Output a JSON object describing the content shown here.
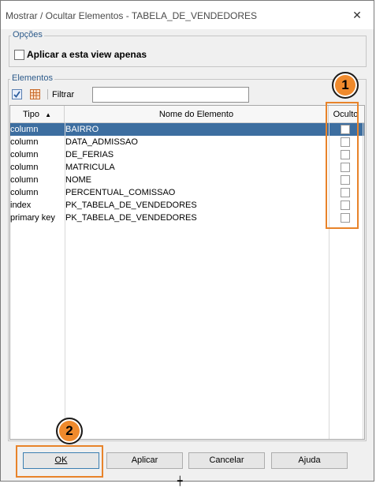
{
  "window": {
    "title": "Mostrar / Ocultar Elementos - TABELA_DE_VENDEDORES",
    "close_glyph": "✕"
  },
  "options": {
    "group_label": "Opções",
    "apply_view_only_label": "Aplicar a esta view apenas",
    "apply_view_only_checked": false
  },
  "elements": {
    "group_label": "Elementos",
    "toolbar": {
      "select_all_icon": "check-all-icon",
      "grid_icon": "table-grid-icon",
      "filter_label": "Filtrar",
      "filter_value": ""
    },
    "table": {
      "columns": {
        "type": "Tipo",
        "name": "Nome do Elemento",
        "hidden": "Oculto"
      },
      "sort_indicator": "▲",
      "rows": [
        {
          "type": "column",
          "name": "BAIRRO",
          "hidden": false,
          "selected": true
        },
        {
          "type": "column",
          "name": "DATA_ADMISSAO",
          "hidden": false,
          "selected": false
        },
        {
          "type": "column",
          "name": "DE_FERIAS",
          "hidden": false,
          "selected": false
        },
        {
          "type": "column",
          "name": "MATRICULA",
          "hidden": false,
          "selected": false
        },
        {
          "type": "column",
          "name": "NOME",
          "hidden": false,
          "selected": false
        },
        {
          "type": "column",
          "name": "PERCENTUAL_COMISSAO",
          "hidden": false,
          "selected": false
        },
        {
          "type": "index",
          "name": "PK_TABELA_DE_VENDEDORES",
          "hidden": false,
          "selected": false
        },
        {
          "type": "primary key",
          "name": "PK_TABELA_DE_VENDEDORES",
          "hidden": false,
          "selected": false
        }
      ]
    }
  },
  "annotations": {
    "badge_1": "1",
    "badge_2": "2",
    "color": "#f08a2c"
  },
  "buttons": {
    "ok": "OK",
    "apply": "Aplicar",
    "cancel": "Cancelar",
    "help": "Ajuda"
  }
}
